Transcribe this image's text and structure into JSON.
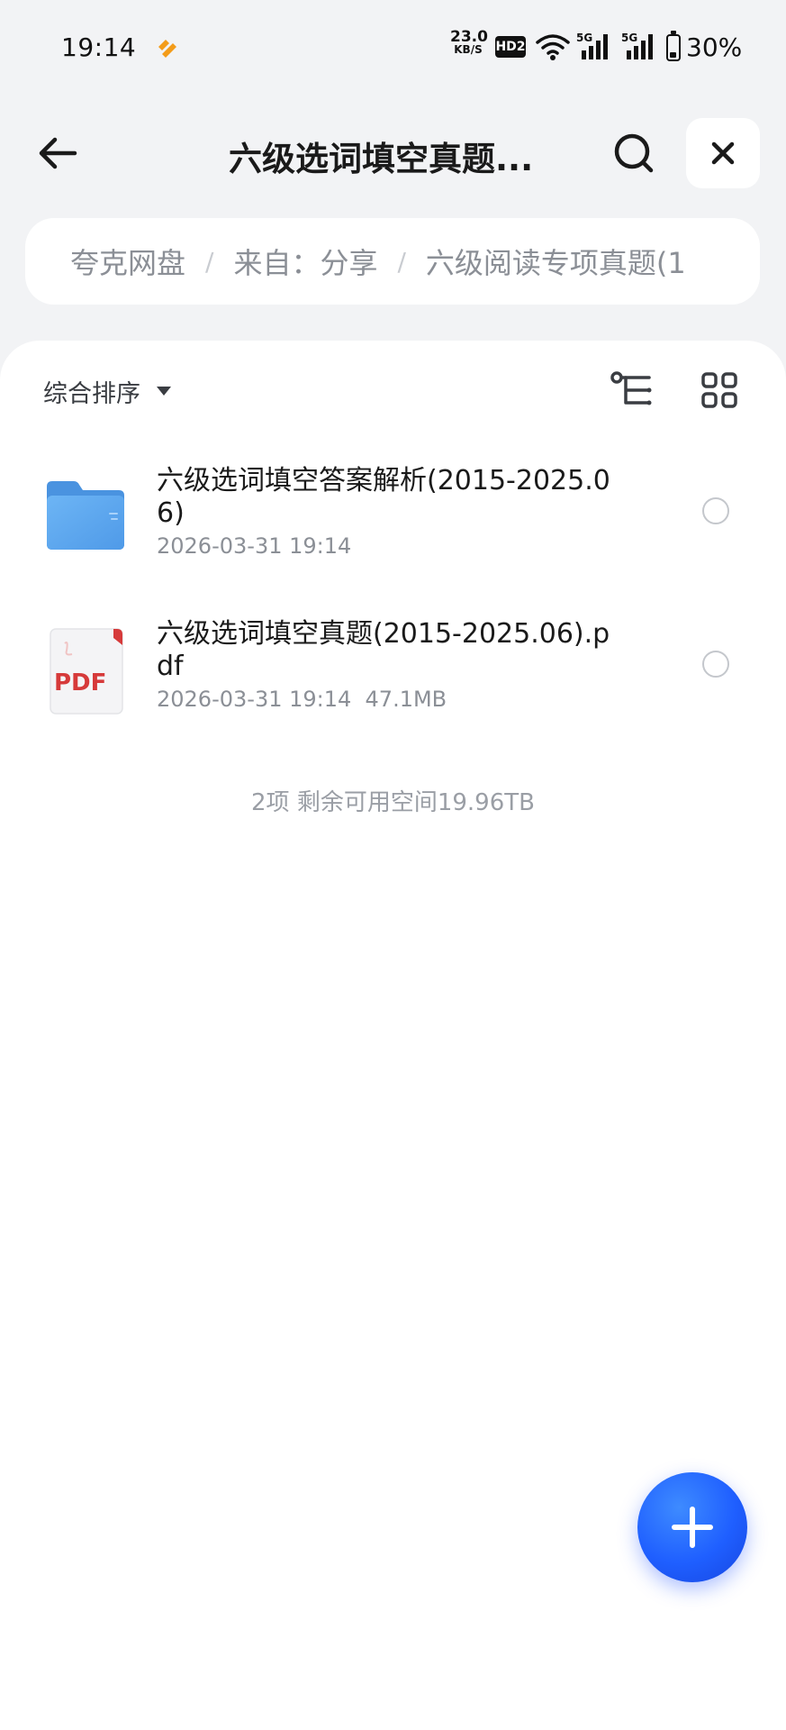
{
  "status_bar": {
    "time": "19:14",
    "app_icon": "quark-app-icon",
    "net_speed_value": "23.0",
    "net_speed_unit": "KB/S",
    "hd_badge": "HD2",
    "signal_1_label": "5G",
    "signal_2_label": "5G",
    "battery_percent_text": "30%",
    "battery_level": 0.3
  },
  "header": {
    "title": "六级选词填空真题...",
    "back_icon": "arrow-left-icon",
    "search_icon": "search-icon",
    "close_icon": "close-icon"
  },
  "breadcrumb": {
    "items": [
      "夸克网盘",
      "来自：分享",
      "六级阅读专项真题(1"
    ],
    "separator": "/"
  },
  "toolbar": {
    "sort_label": "综合排序",
    "tree_view_icon": "tree-view-icon",
    "grid_view_icon": "grid-view-icon"
  },
  "files": [
    {
      "name": "六级选词填空答案解析(2015-2025.06)",
      "meta": "2026-03-31 19:14",
      "type": "folder",
      "icon": "folder-icon"
    },
    {
      "name": "六级选词填空真题(2015-2025.06).pdf",
      "meta": "2026-03-31 19:14  47.1MB",
      "type": "pdf",
      "icon": "pdf-file-icon",
      "icon_text": "PDF"
    }
  ],
  "summary": "2项 剩余可用空间19.96TB",
  "fab": {
    "icon": "plus-icon"
  },
  "colors": {
    "accent": "#1f5fff",
    "background": "#f2f3f5",
    "folder": "#5aa9f0",
    "pdf_red": "#d63a3a",
    "secondary_text": "#8b8f96"
  }
}
